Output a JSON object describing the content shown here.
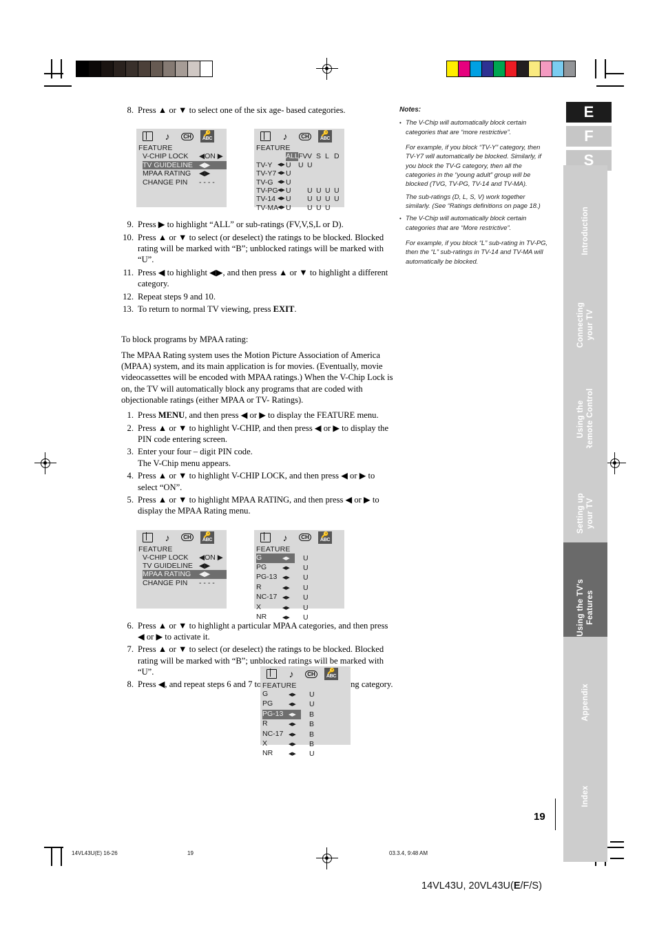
{
  "page": {
    "number": "19",
    "footer_left": "14VL43U(E) 16-26",
    "footer_center": "19",
    "footer_time": "03.3.4, 9:48 AM",
    "model_prefix": "14VL43U, 20VL43U(",
    "model_bold": "E",
    "model_suffix": "/F/S)"
  },
  "color_bars": {
    "gray": [
      "#000000",
      "#0b0807",
      "#1a1411",
      "#2a221e",
      "#39302b",
      "#4c4039",
      "#665a52",
      "#857a73",
      "#a69c96",
      "#d0c8c4",
      "#ffffff"
    ],
    "color": [
      "#ffed00",
      "#e6007e",
      "#00a0e3",
      "#2e3192",
      "#00a651",
      "#ed1c24",
      "#231f20",
      "#faea80",
      "#f49ac1",
      "#7accf0",
      "#939598"
    ]
  },
  "steps_top": [
    {
      "num": "8.",
      "text": "Press ▲ or ▼ to select one of the six age- based categories."
    }
  ],
  "steps_mid": [
    {
      "num": "9.",
      "text": "Press ▶ to highlight “ALL” or sub-ratings (FV,V,S,L or D)."
    },
    {
      "num": "10.",
      "text": "Press ▲ or ▼ to select (or deselect) the ratings to be blocked. Blocked rating will be marked with “B”; unblocked ratings will be marked with “U”."
    },
    {
      "num": "11.",
      "text": "Press ◀ to highlight ◀▶, and then press ▲ or ▼ to highlight a different category."
    },
    {
      "num": "12.",
      "text": "Repeat steps 9 and 10."
    },
    {
      "num": "13.",
      "pre": "To return to normal TV viewing, press ",
      "bold": "EXIT",
      "post": "."
    }
  ],
  "mpaa_section": {
    "heading": "To block programs by MPAA rating:",
    "body": "The MPAA Rating system uses the Motion Picture Association of America (MPAA) system, and its main application is for movies. (Eventually, movie videocassettes will be encoded with MPAA ratings.) When the V-Chip Lock is on, the TV will automatically  block any programs that are coded with objectionable ratings (either MPAA or TV- Ratings).",
    "steps": [
      {
        "num": "1.",
        "pre": "Press ",
        "bold": "MENU",
        "post": ", and then press ◀ or ▶ to display the FEATURE menu."
      },
      {
        "num": "2.",
        "text": "Press ▲ or ▼ to highlight V-CHIP, and then press ◀ or ▶ to display the PIN code entering screen."
      },
      {
        "num": "3.",
        "text": "Enter your four – digit PIN code.\nThe V-Chip menu appears."
      },
      {
        "num": "4.",
        "text": "Press ▲ or ▼ to highlight V-CHIP LOCK, and then press ◀ or ▶ to select “ON”."
      },
      {
        "num": "5.",
        "text": "Press ▲ or ▼ to highlight MPAA RATING, and then press ◀ or ▶ to display the MPAA Rating menu."
      }
    ],
    "steps_after": [
      {
        "num": "6.",
        "text": "Press ▲ or ▼ to highlight a particular MPAA categories, and then press ◀ or ▶ to activate it."
      },
      {
        "num": "7.",
        "text": "Press ▲ or ▼ to select (or deselect) the ratings to be blocked. Blocked rating will be marked with “B”; unblocked ratings will be marked with “U”."
      },
      {
        "num": "8.",
        "text": "Press ◀, and repeat steps 6 and 7 to set a different MPAA rating category."
      }
    ]
  },
  "osd": {
    "icons": [
      "picture-icon",
      "audio-note-icon",
      "channel-icon",
      "lock-abc-icon"
    ],
    "title": "FEATURE",
    "feature_menu_1": {
      "rows": [
        {
          "label": "V-CHIP LOCK",
          "value": "◀ON ▶",
          "highlighted": false
        },
        {
          "label": "TV GUIDELINE",
          "value": "◀▶",
          "highlighted": true
        },
        {
          "label": "MPAA RATING",
          "value": "◀▶",
          "highlighted": false
        },
        {
          "label": "CHANGE PIN",
          "value": "- - - -",
          "highlighted": false
        }
      ]
    },
    "feature_menu_2": {
      "rows": [
        {
          "label": "V-CHIP LOCK",
          "value": "◀ON ▶",
          "highlighted": false
        },
        {
          "label": "TV GUIDELINE",
          "value": "◀▶",
          "highlighted": false
        },
        {
          "label": "MPAA RATING",
          "value": "◀▶",
          "highlighted": true
        },
        {
          "label": "CHANGE PIN",
          "value": "- - - -",
          "highlighted": false
        }
      ]
    },
    "tv_guideline": {
      "columns": [
        "ALL",
        "FV",
        "V",
        "S",
        "L",
        "D"
      ],
      "highlighted_column": "ALL",
      "rows": [
        {
          "label": "TV-Y",
          "arrows": "◀▶",
          "cells": [
            "U",
            "U",
            "U",
            "",
            "",
            ""
          ]
        },
        {
          "label": "TV-Y7",
          "arrows": "◀▶",
          "cells": [
            "U",
            "",
            "",
            "",
            "",
            ""
          ]
        },
        {
          "label": "TV-G",
          "arrows": "◀▶",
          "cells": [
            "U",
            "",
            "",
            "",
            "",
            ""
          ]
        },
        {
          "label": "TV-PG",
          "arrows": "◀▶",
          "cells": [
            "U",
            "",
            "U",
            "U",
            "U",
            "U"
          ]
        },
        {
          "label": "TV-14",
          "arrows": "◀▶",
          "cells": [
            "U",
            "",
            "U",
            "U",
            "U",
            "U"
          ]
        },
        {
          "label": "TV-MA",
          "arrows": "◀▶",
          "cells": [
            "U",
            "",
            "U",
            "U",
            "U",
            ""
          ]
        }
      ]
    },
    "mpaa_unblocked": {
      "rows": [
        {
          "label": "G",
          "arrows": "◀▶",
          "value": "U",
          "highlighted": true
        },
        {
          "label": "PG",
          "arrows": "◀▶",
          "value": "U",
          "highlighted": false
        },
        {
          "label": "PG-13",
          "arrows": "◀▶",
          "value": "U",
          "highlighted": false
        },
        {
          "label": "R",
          "arrows": "◀▶",
          "value": "U",
          "highlighted": false
        },
        {
          "label": "NC-17",
          "arrows": "◀▶",
          "value": "U",
          "highlighted": false
        },
        {
          "label": "X",
          "arrows": "◀▶",
          "value": "U",
          "highlighted": false
        },
        {
          "label": "NR",
          "arrows": "◀▶",
          "value": "U",
          "highlighted": false
        }
      ]
    },
    "mpaa_blocked": {
      "rows": [
        {
          "label": "G",
          "arrows": "◀▶",
          "value": "U",
          "highlighted": false
        },
        {
          "label": "PG",
          "arrows": "◀▶",
          "value": "U",
          "highlighted": false
        },
        {
          "label": "PG-13",
          "arrows": "◀▶",
          "value": "B",
          "highlighted": true
        },
        {
          "label": "R",
          "arrows": "◀▶",
          "value": "B",
          "highlighted": false
        },
        {
          "label": "NC-17",
          "arrows": "◀▶",
          "value": "B",
          "highlighted": false
        },
        {
          "label": "X",
          "arrows": "◀▶",
          "value": "B",
          "highlighted": false
        },
        {
          "label": "NR",
          "arrows": "◀▶",
          "value": "U",
          "highlighted": false
        }
      ]
    }
  },
  "notes": {
    "heading": "Notes:",
    "items": [
      {
        "bullet": "•",
        "text": "The V-Chip will automatically block certain categories that are “more restrictive”.",
        "subs": [
          "For example, if you block “TV-Y” category, then TV-Y7 will automatically be blocked. Similarly, if you block the TV-G category, then all the categories in the “young adult” group will be blocked (TVG, TV-PG, TV-14 and TV-MA).",
          "The sub-ratings (D, L, S, V) work together similarly. (See “Ratings definitions on page 18.)"
        ]
      },
      {
        "bullet": "•",
        "text": "The V-Chip will automatically block certain categories that are “More restrictive”.",
        "subs": [
          "For example, if you block “L” sub-rating in TV-PG, then the “L” sub-ratings in TV-14 and TV-MA will automatically be blocked."
        ]
      }
    ]
  },
  "lang_tabs": [
    {
      "label": "E",
      "active": true
    },
    {
      "label": "F",
      "active": false
    },
    {
      "label": "S",
      "active": false
    }
  ],
  "section_tabs": [
    {
      "label": "Introduction",
      "active": false
    },
    {
      "label": "Connecting\nyour TV",
      "active": false
    },
    {
      "label": "Using the\nRemote Control",
      "active": false
    },
    {
      "label": "Setting up\nyour TV",
      "active": false
    },
    {
      "label": "Using the TV's\nFeatures",
      "active": true
    },
    {
      "label": "Appendix",
      "active": false
    },
    {
      "label": "Index",
      "active": false
    }
  ]
}
